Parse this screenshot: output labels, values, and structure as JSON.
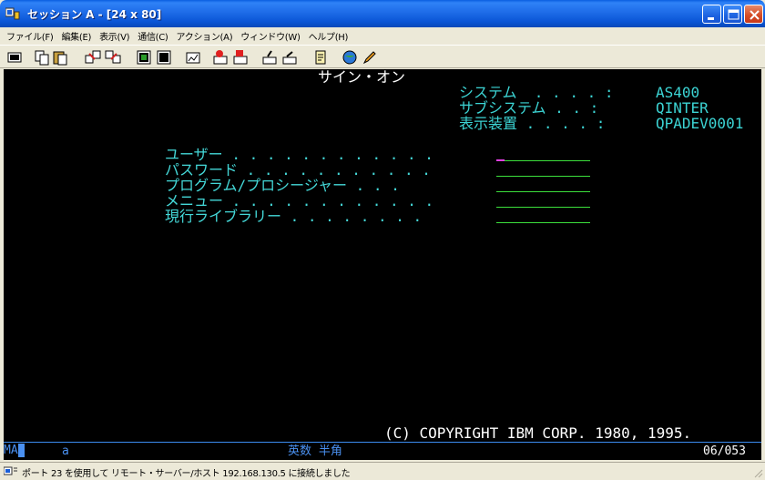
{
  "window": {
    "title": "セッション A - [24 x 80]"
  },
  "menu": [
    "ファイル(F)",
    "編集(E)",
    "表示(V)",
    "通信(C)",
    "アクション(A)",
    "ウィンドウ(W)",
    "ヘルプ(H)"
  ],
  "toolbar": {
    "buttons": [
      "print-screen",
      "copy",
      "paste",
      "send",
      "receive",
      "display-list",
      "macro-record",
      "macro-play",
      "keypad",
      "color-map",
      "map",
      "connect",
      "disconnect",
      "notes",
      "help"
    ]
  },
  "terminal": {
    "header": "サイン・オン",
    "system_rows": [
      {
        "label": "システム  . . . . :",
        "value": "AS400"
      },
      {
        "label": "サブシステム . . :",
        "value": "QINTER"
      },
      {
        "label": "表示装置 . . . . :",
        "value": "QPADEV0001"
      }
    ],
    "fields": [
      {
        "label": "ユーザー . . . . . . . . . . . .",
        "value": ""
      },
      {
        "label": "パスワード . . . . . . . . . . .",
        "value": ""
      },
      {
        "label": "プログラム/プロシージャー . . .",
        "value": ""
      },
      {
        "label": "メニュー . . . . . . . . . . . .",
        "value": ""
      },
      {
        "label": "現行ライブラリー . . . . . . . .",
        "value": ""
      }
    ],
    "copyright": "(C) COPYRIGHT IBM CORP. 1980, 1995."
  },
  "oia": {
    "ma": "MA",
    "indicator": "a",
    "mode": "英数 半角",
    "cursor_position": "06/053"
  },
  "status": {
    "message": "ポート 23 を使用して リモート・サーバー/ホスト 192.168.130.5 に接続しました"
  },
  "colors": {
    "terminal_bg": "#000000",
    "label_cyan": "#3CD4D4",
    "field_underline": "#3CE03C",
    "title_blue": "#0A55D5"
  }
}
